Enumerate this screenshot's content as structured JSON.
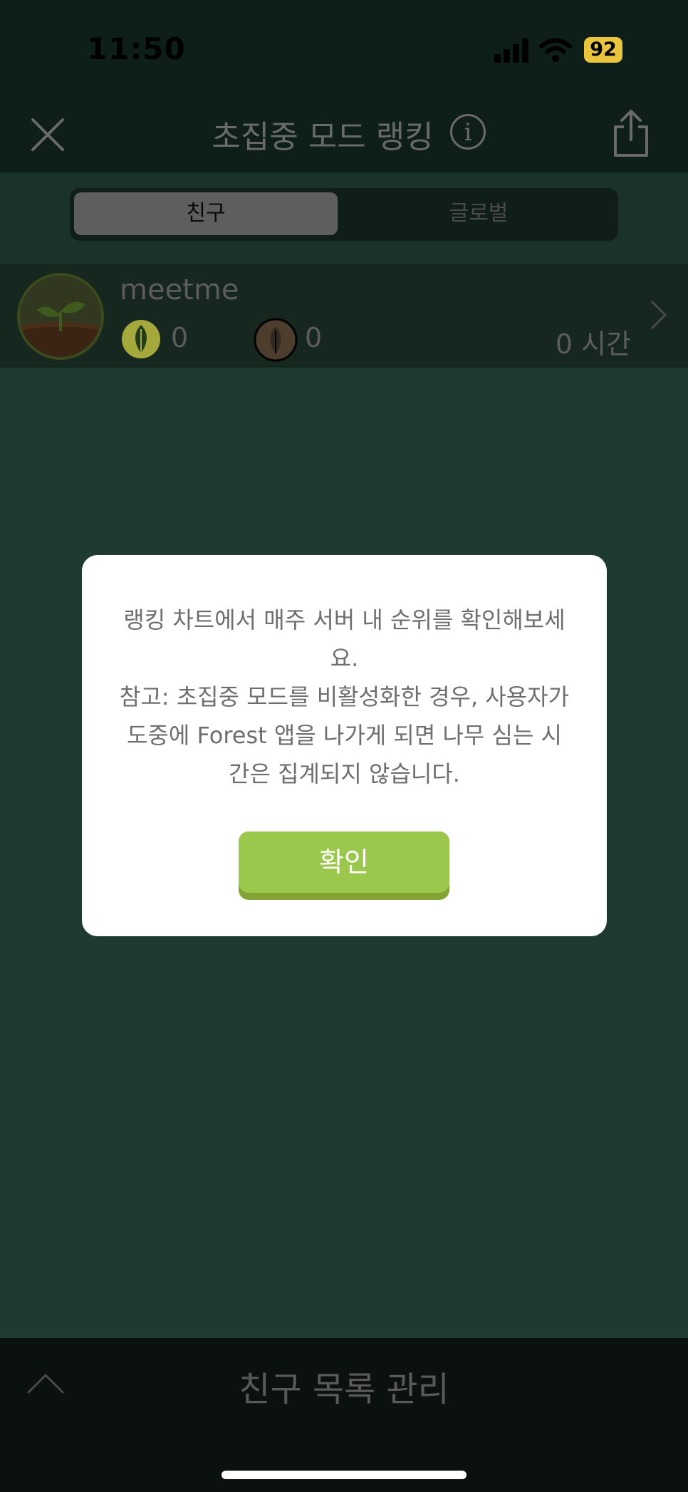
{
  "status_bar": {
    "time": "11:50",
    "battery": "92"
  },
  "header": {
    "title": "초집중 모드 랭킹"
  },
  "tabs": [
    {
      "label": "친구",
      "active": true
    },
    {
      "label": "글로벌",
      "active": false
    }
  ],
  "ranking": {
    "rows": [
      {
        "username": "meetme",
        "healthy_trees": "0",
        "withered_trees": "0",
        "hours": "0 시간"
      }
    ]
  },
  "dialog": {
    "message_line1": "랭킹 차트에서 매주 서버 내 순위를 확인해보세요.",
    "message_line2": "참고: 초집중 모드를 비활성화한 경우, 사용자가 도중에 Forest 앱을 나가게 되면 나무 심는 시간은 집계되지 않습니다.",
    "confirm_label": "확인"
  },
  "footer": {
    "manage_label": "친구 목록 관리"
  },
  "colors": {
    "accent": "#9bc84c",
    "background": "#1f3b31",
    "battery": "#e9c43c"
  }
}
